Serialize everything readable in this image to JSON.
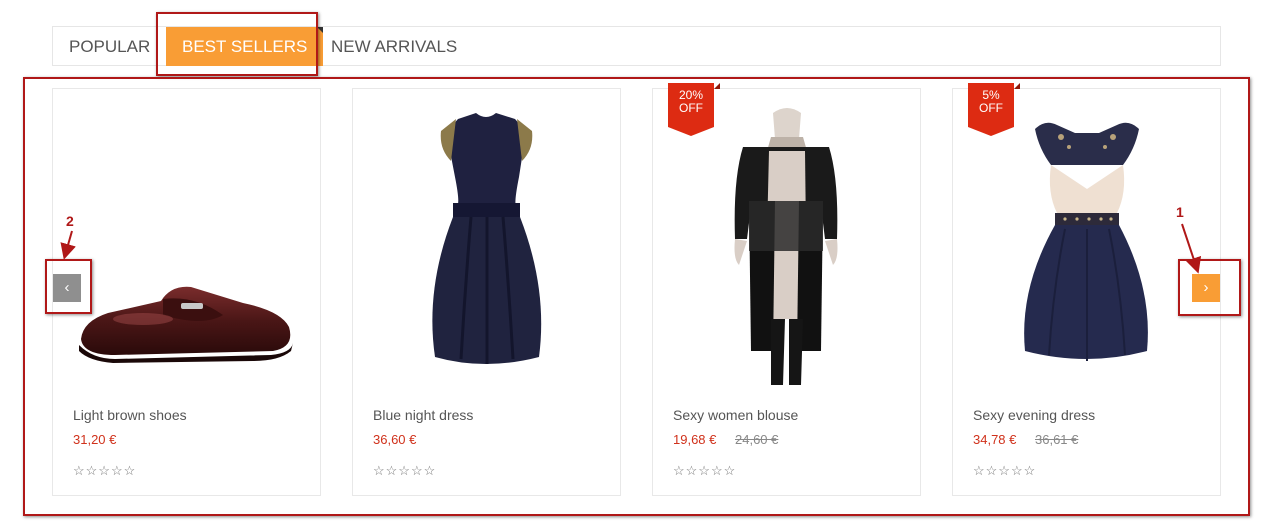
{
  "tabs": [
    {
      "label": "POPULAR"
    },
    {
      "label": "BEST SELLERS"
    },
    {
      "label": "NEW ARRIVALS"
    }
  ],
  "products": [
    {
      "name": "Light brown shoes",
      "price": "31,20 €",
      "old_price": "",
      "badge_line1": "",
      "badge_line2": "",
      "rating_stars": "☆☆☆☆☆"
    },
    {
      "name": "Blue night dress",
      "price": "36,60 €",
      "old_price": "",
      "badge_line1": "",
      "badge_line2": "",
      "rating_stars": "☆☆☆☆☆"
    },
    {
      "name": "Sexy women blouse",
      "price": "19,68 €",
      "old_price": "24,60 €",
      "badge_line1": "20%",
      "badge_line2": "OFF",
      "rating_stars": "☆☆☆☆☆"
    },
    {
      "name": "Sexy evening dress",
      "price": "34,78 €",
      "old_price": "36,61 €",
      "badge_line1": "5%",
      "badge_line2": "OFF",
      "rating_stars": "☆☆☆☆☆"
    }
  ],
  "nav": {
    "prev_glyph": "‹",
    "next_glyph": "›"
  },
  "annotations": {
    "label_1": "1",
    "label_2": "2"
  },
  "colors": {
    "accent": "#f99d35",
    "price_red": "#d0311b",
    "badge_red": "#dd2b12",
    "annotation_red": "#b01818"
  }
}
